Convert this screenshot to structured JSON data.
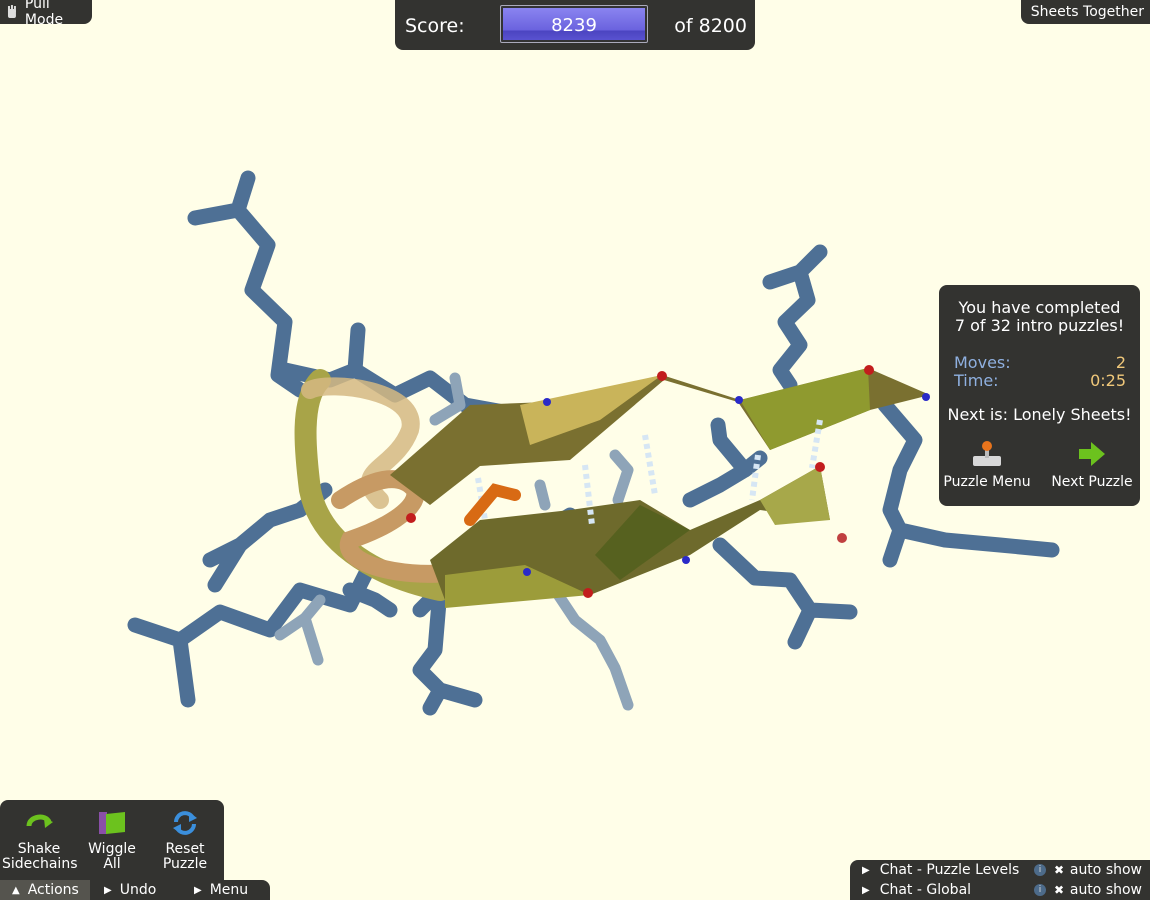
{
  "mode": {
    "label": "Pull Mode",
    "icon": "hand-icon"
  },
  "puzzle_name": "Sheets Together",
  "score": {
    "label": "Score:",
    "value": "8239",
    "target": "of 8200"
  },
  "completed": {
    "line1": "You have completed",
    "line2": "7 of 32 intro puzzles!",
    "moves_label": "Moves:",
    "moves_value": "2",
    "time_label": "Time:",
    "time_value": "0:25",
    "next_text": "Next is: Lonely Sheets!",
    "menu_button": "Puzzle Menu",
    "next_button": "Next Puzzle"
  },
  "actions": {
    "shake_line1": "Shake",
    "shake_line2": "Sidechains",
    "wiggle_line1": "Wiggle",
    "wiggle_line2": "All",
    "reset_line1": "Reset",
    "reset_line2": "Puzzle"
  },
  "bottom_tabs": {
    "actions": "Actions",
    "undo": "Undo",
    "menu": "Menu"
  },
  "chat": {
    "levels": "Chat - Puzzle Levels",
    "global": "Chat - Global",
    "auto_show": "auto show"
  },
  "colors": {
    "background": "#fffee8",
    "panel": "#333330",
    "sidechain": "#4e7095",
    "sheet": "#8a7f3a",
    "score_fill": "#6a62de"
  }
}
